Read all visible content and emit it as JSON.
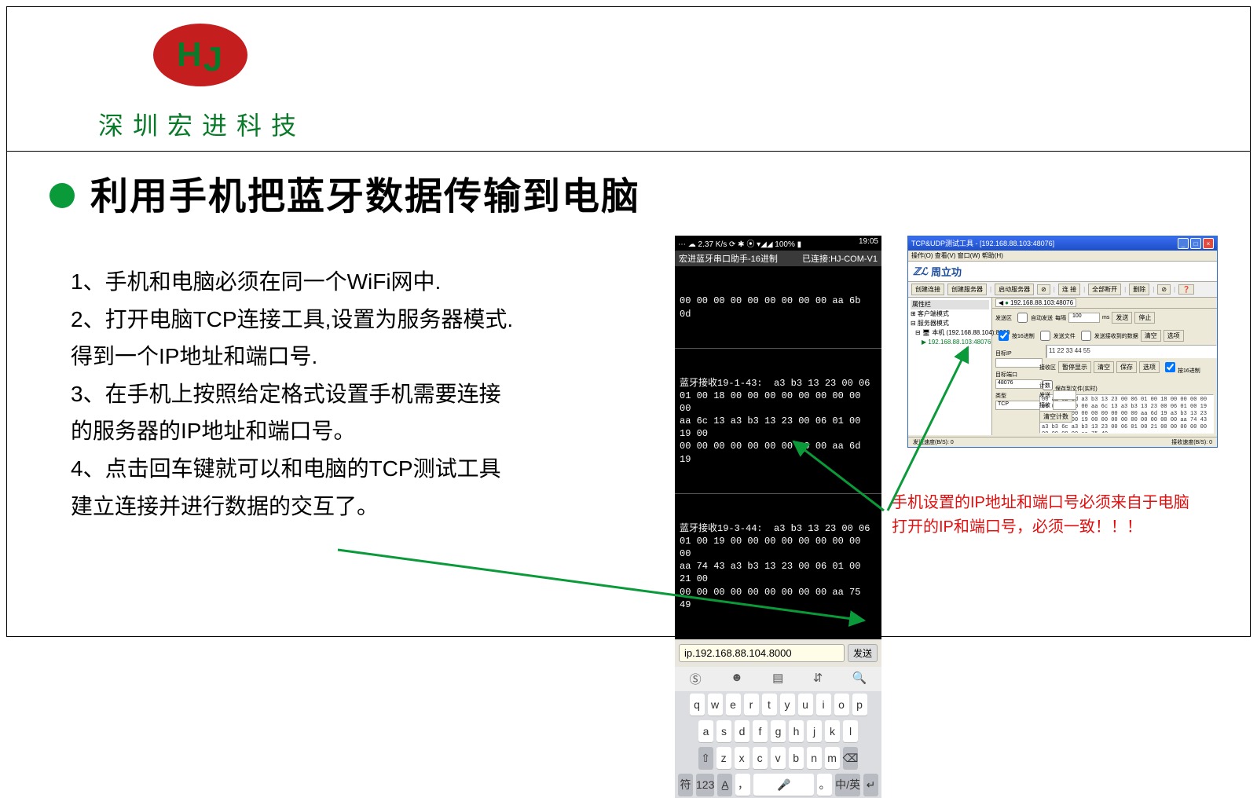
{
  "branding": {
    "logo_text_H": "H",
    "logo_text_J": "J",
    "company_name": "深圳宏进科技"
  },
  "slide": {
    "title": "利用手机把蓝牙数据传输到电脑",
    "step1": "1、手机和电脑必须在同一个WiFi网中.",
    "step2": "2、打开电脑TCP连接工具,设置为服务器模式.",
    "step2b": "得到一个IP地址和端口号.",
    "step3": "3、在手机上按照给定格式设置手机需要连接",
    "step3b": "的服务器的IP地址和端口号。",
    "step4": "4、点击回车键就可以和电脑的TCP测试工具",
    "step4b": "建立连接并进行数据的交互了。",
    "note_line1": "手机设置的IP地址和端口号必须来自于电脑",
    "note_line2": "打开的IP和端口号，必须一致！！！"
  },
  "phone": {
    "status_left": "⋯ ☁  2.37 K/s ⟳ ✱ ⦿ ▾◢◢ 100% ▮",
    "status_right": "19:05",
    "app_title_left": "宏进蓝牙串口助手-16进制",
    "app_title_right": "已连接:HJ-COM-V1",
    "stream_top": "00 00 00 00 00 00 00 00 00 aa 6b 0d",
    "stream_block1": "蓝牙接收19-1-43:  a3 b3 13 23 00 06\n01 00 18 00 00 00 00 00 00 00 00 00\naa 6c 13 a3 b3 13 23 00 06 01 00 19 00\n00 00 00 00 00 00 00 00 00 aa 6d 19",
    "stream_block2": "蓝牙接收19-3-44:  a3 b3 13 23 00 06\n01 00 19 00 00 00 00 00 00 00 00 00\naa 74 43 a3 b3 13 23 00 06 01 00 21 00\n00 00 00 00 00 00 00 00 00 aa 75 49",
    "input_value": "ip.192.168.88.104.8000",
    "send_label": "发送",
    "toolbar_icons": [
      "Ⓢ",
      "☻",
      "▤",
      "⇵",
      "🔍"
    ],
    "kb_row1": [
      "q",
      "w",
      "e",
      "r",
      "t",
      "y",
      "u",
      "i",
      "o",
      "p"
    ],
    "kb_row2": [
      "a",
      "s",
      "d",
      "f",
      "g",
      "h",
      "j",
      "k",
      "l"
    ],
    "kb_row3_shift": "⇧",
    "kb_row3": [
      "z",
      "x",
      "c",
      "v",
      "b",
      "n",
      "m"
    ],
    "kb_row3_bksp": "⌫",
    "kb_row4": [
      "符",
      "123",
      "A̲",
      "，",
      "🎤",
      "。",
      "中/英",
      "↵"
    ]
  },
  "windows": {
    "title": "TCP&UDP测试工具 - [192.168.88.103:48076]",
    "menu": "操作(O)  查看(V)  窗口(W)  帮助(H)",
    "logo_brand": "周立功",
    "toolbar": [
      "创建连接",
      "创建服务器",
      "❘",
      "启动服务器",
      "⊘",
      "❘",
      "连 接",
      "❘",
      "全部断开",
      "❘",
      "删除",
      "❘",
      "⊘",
      "❘",
      "❓"
    ],
    "tree_root": "属性栏",
    "tree_mode": "⊞ 客户端模式",
    "tree_srvmode": "⊟ 服务器模式",
    "tree_local": "⊟ 🖥 本机 (192.168.88.104):8000",
    "tree_client": "▶ 192.168.88.103:48076",
    "tab_ip": "192.168.88.103:48076",
    "ctrl_target_lbl": "目标IP",
    "ctrl_send_area_lbl": "发送区",
    "ctrl_auto_lbl": "自动发送",
    "ctrl_interval_lbl": "每隔",
    "ctrl_interval_val": "100",
    "ctrl_ms_lbl": "ms",
    "ctrl_send_btn": "发送",
    "ctrl_stop_btn": "停止",
    "left_target_ip": "目标IP",
    "left_target_port": "目标端口",
    "left_target_port_val": "48076",
    "left_type": "类型",
    "left_type_val": "TCP",
    "send_content": "11 22 33 44 55",
    "chk_hex_send": "按16进制",
    "chk_send_file": "发送文件",
    "chk_recv_save": "发送接收到的数据",
    "act_recv_area": "接收区",
    "act_pause": "暂停显示",
    "act_clear": "清空",
    "act_save": "保存",
    "act_options": "选项",
    "act_hex16": "按16进制",
    "act_saveto": "保存到文件(实时)",
    "recv_hex": "00 aa 6b 0d a3 b3 13 23 00 06 01 00 18 00 00 00 00 00 00 00 00 00 aa\n6c 13 a3 b3 13 23 00 06 01 00 19 00 00 00 00 00 00 00 00 00 00 aa 6d 19\na3 b3 13 23 00 06 01 00 19 00 00 00 00 00 00 00 00 00 aa 74 43 a3 b3\n6c a3 b3 13 23 00 06 01 00 21 00 00 00 00 00 00 00 00 00 aa 75 49",
    "count_lbl": "计数",
    "count_send_lbl": "发送",
    "count_recv_lbl": "接收",
    "count_clear_btn": "清空计数",
    "status_left": "发送速度(B/S): 0",
    "status_right": "接收速度(B/S): 0",
    "clear_lbl": "清空",
    "options_lbl": "选项"
  }
}
